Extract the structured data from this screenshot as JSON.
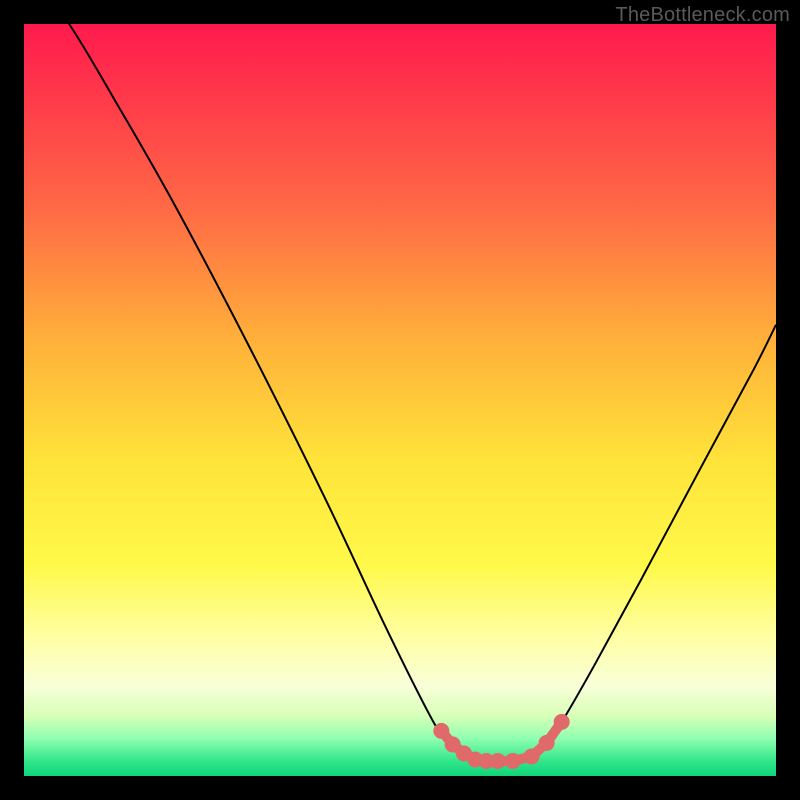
{
  "watermark": "TheBottleneck.com",
  "curve": {
    "stroke": "#000000",
    "highlight_stroke": "#e06a6a",
    "highlight_fill": "#e06a6a"
  },
  "chart_data": {
    "type": "line",
    "title": "",
    "xlabel": "",
    "ylabel": "",
    "xlim": [
      0,
      100
    ],
    "ylim": [
      0,
      100
    ],
    "series": [
      {
        "name": "bottleneck-curve",
        "x": [
          0,
          6,
          12,
          20,
          30,
          40,
          48,
          54,
          56,
          58,
          60,
          62,
          65,
          68,
          70,
          72,
          76,
          82,
          90,
          97,
          100
        ],
        "y": [
          108,
          100,
          90,
          76,
          57,
          37,
          20,
          8,
          5,
          3,
          2,
          2,
          2,
          3,
          5,
          8,
          15,
          26,
          41,
          54,
          60
        ]
      }
    ],
    "highlight_points": {
      "name": "optimal-region",
      "x": [
        55.5,
        57.0,
        58.5,
        60.0,
        61.5,
        63.0,
        65.0,
        67.5,
        69.5,
        71.5
      ],
      "y": [
        6.0,
        4.2,
        3.0,
        2.2,
        2.0,
        2.0,
        2.0,
        2.6,
        4.4,
        7.2
      ]
    }
  }
}
